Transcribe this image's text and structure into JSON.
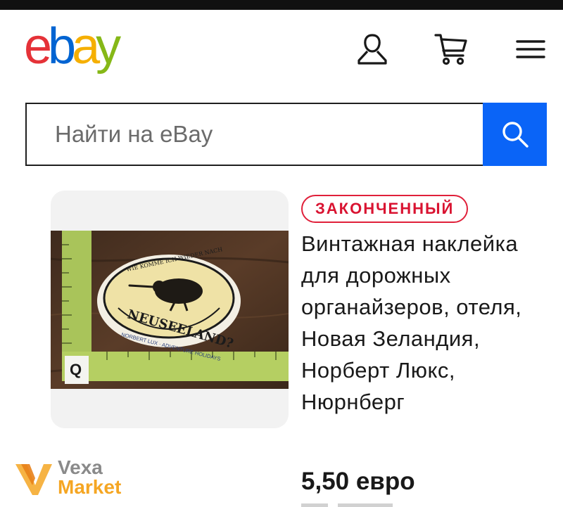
{
  "header": {
    "logo": {
      "letters": [
        "e",
        "b",
        "a",
        "y"
      ],
      "colors": [
        "#e53238",
        "#0064d2",
        "#f5af02",
        "#86b817"
      ]
    },
    "icons": [
      "user-icon",
      "cart-icon",
      "menu-icon"
    ]
  },
  "search": {
    "placeholder": "Найти на eBay",
    "button_icon": "search-icon",
    "button_color": "#0a64f7"
  },
  "listing": {
    "status_badge": "ЗАКОНЧЕННЫЙ",
    "title": "Винтажная наклейка для дорожных органайзеров, отеля, Новая Зеландия, Норберт Люкс, Нюрнберг",
    "price": "5,50 евро",
    "photo": {
      "sticker_top_text": "WIE KOMME ICH WIEDER NACH",
      "sticker_main_text": "NEUSEELAND?",
      "sticker_bottom_text": "NORBERT LUX · ADVENTURE HOLIDAYS",
      "ruler_letter": "Q"
    }
  },
  "watermark": {
    "line1": "Vexa",
    "line2": "Market"
  }
}
